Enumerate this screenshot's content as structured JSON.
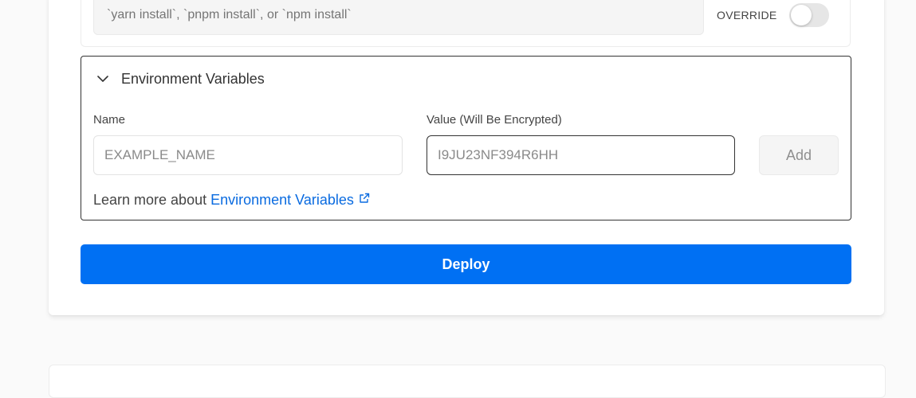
{
  "install": {
    "placeholder": "`yarn install`, `pnpm install`, or `npm install`",
    "override_label": "OVERRIDE",
    "override_enabled": false
  },
  "env": {
    "title": "Environment Variables",
    "name_label": "Name",
    "name_placeholder": "EXAMPLE_NAME",
    "value_label": "Value (Will Be Encrypted)",
    "value_placeholder": "I9JU23NF394R6HH",
    "add_label": "Add",
    "learn_prefix": "Learn more about",
    "learn_link": "Environment Variables"
  },
  "deploy": {
    "label": "Deploy"
  },
  "colors": {
    "primary": "#0070f3",
    "link": "#0a6be0"
  },
  "icons": {
    "collapse": "chevron-down-icon",
    "external": "external-link-icon"
  }
}
